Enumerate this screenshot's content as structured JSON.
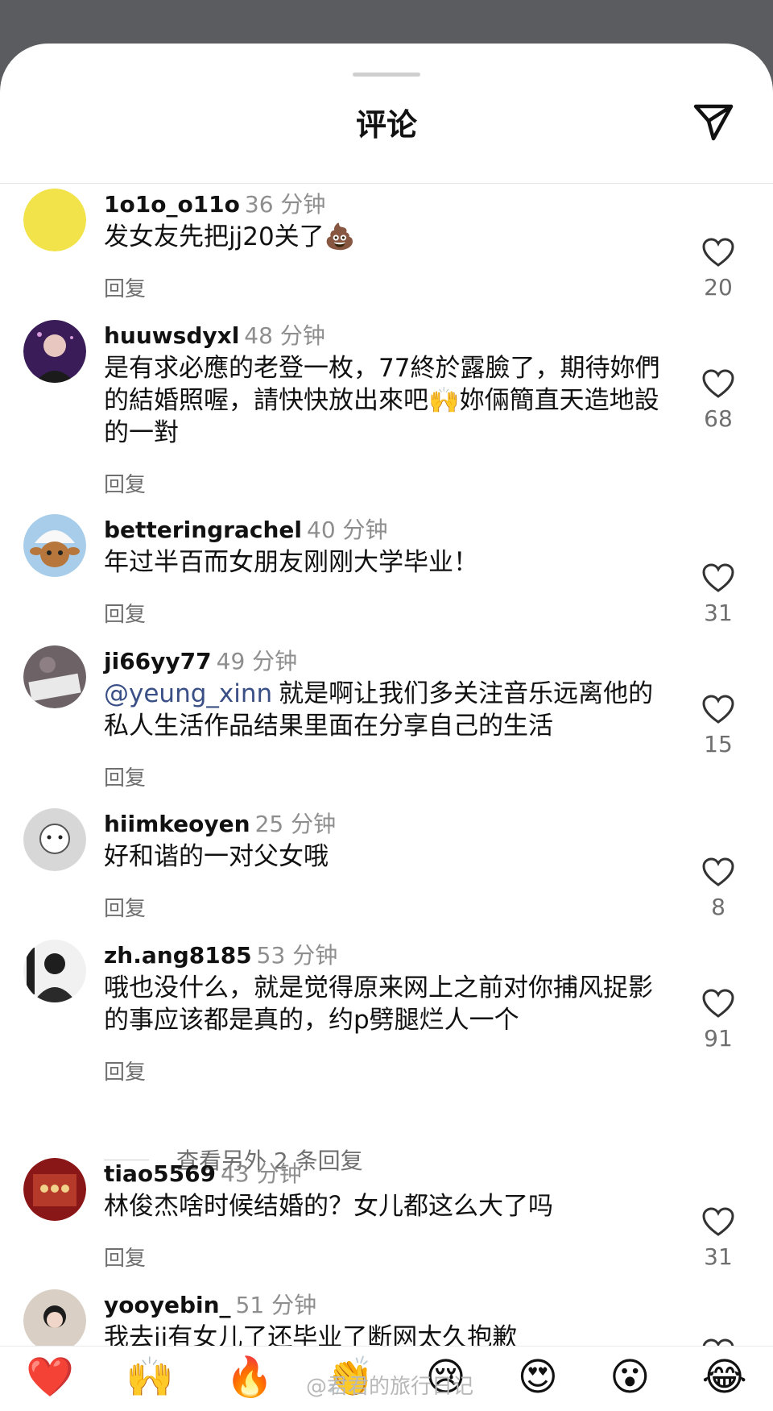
{
  "header": {
    "title": "评论"
  },
  "comments": [
    {
      "user": "1o1o_o11o",
      "time": "36 分钟",
      "text": "发女友先把jj20关了💩",
      "mention": "",
      "reply": "回复",
      "likes": "20",
      "avatar_color": "#f2e34a"
    },
    {
      "user": "huuwsdyxl",
      "time": "48 分钟",
      "text": "是有求必應的老登一枚，77終於露臉了，期待妳們的結婚照喔，請快快放出來吧🙌妳倆簡直天造地設的一對",
      "mention": "",
      "reply": "回复",
      "likes": "68",
      "avatar_color": "#4a2a6a"
    },
    {
      "user": "betteringrachel",
      "time": "40 分钟",
      "text": "年过半百而女朋友刚刚大学毕业！",
      "mention": "",
      "reply": "回复",
      "likes": "31",
      "avatar_color": "#9cc6e6"
    },
    {
      "user": "ji66yy77",
      "time": "49 分钟",
      "text": "就是啊让我们多关注音乐远离他的私人生活作品结果里面在分享自己的生活",
      "mention": "@yeung_xinn",
      "reply": "回复",
      "likes": "15",
      "avatar_color": "#7a6f72"
    },
    {
      "user": "hiimkeoyen",
      "time": "25 分钟",
      "text": "好和谐的一对父女哦",
      "mention": "",
      "reply": "回复",
      "likes": "8",
      "avatar_color": "#dcdcdc"
    },
    {
      "user": "zh.ang8185",
      "time": "53 分钟",
      "text": "哦也没什么，就是觉得原来网上之前对你捕风捉影的事应该都是真的，约p劈腿烂人一个",
      "mention": "",
      "reply": "回复",
      "likes": "91",
      "avatar_color": "#2a2a2a"
    },
    {
      "user": "tiao5569",
      "time": "43 分钟",
      "text": "林俊杰啥时候结婚的？女儿都这么大了吗",
      "mention": "",
      "reply": "回复",
      "likes": "31",
      "avatar_color": "#8a1a1a"
    },
    {
      "user": "yooyebin_",
      "time": "51 分钟",
      "text": "我去jj有女儿了还毕业了断网太久抱歉",
      "mention": "",
      "reply": "",
      "likes": "",
      "avatar_color": "#d9cfc4"
    }
  ],
  "more_replies": "查看另外 2 条回复",
  "emoji_bar": [
    "❤️",
    "🙌",
    "🔥",
    "👏",
    "😢",
    "😍",
    "😮",
    "😂"
  ],
  "watermark": "@君君的旅行日记"
}
